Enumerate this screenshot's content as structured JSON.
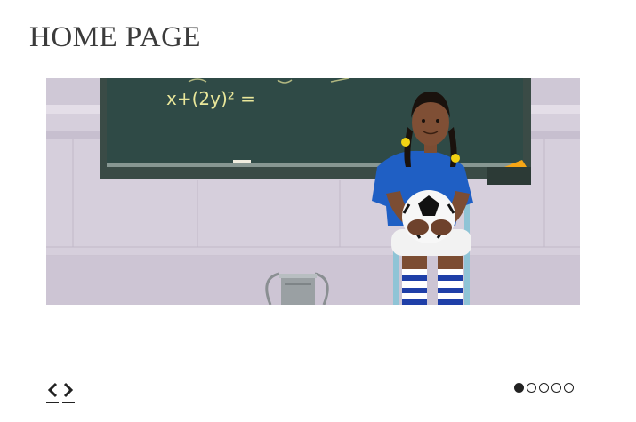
{
  "page": {
    "title": "HOME PAGE"
  },
  "slider": {
    "slide_image": "girl-with-soccer-ball-in-classroom",
    "chalkboard_text": "x+(2y)² =",
    "prev_icon": "chevron-left-icon",
    "next_icon": "chevron-right-icon",
    "pager": {
      "total": 5,
      "active_index": 0
    }
  },
  "colors": {
    "title": "#3b3b3b",
    "controls": "#222222",
    "chalkboard": "#2f4a46",
    "shirt": "#1f5fc4"
  }
}
